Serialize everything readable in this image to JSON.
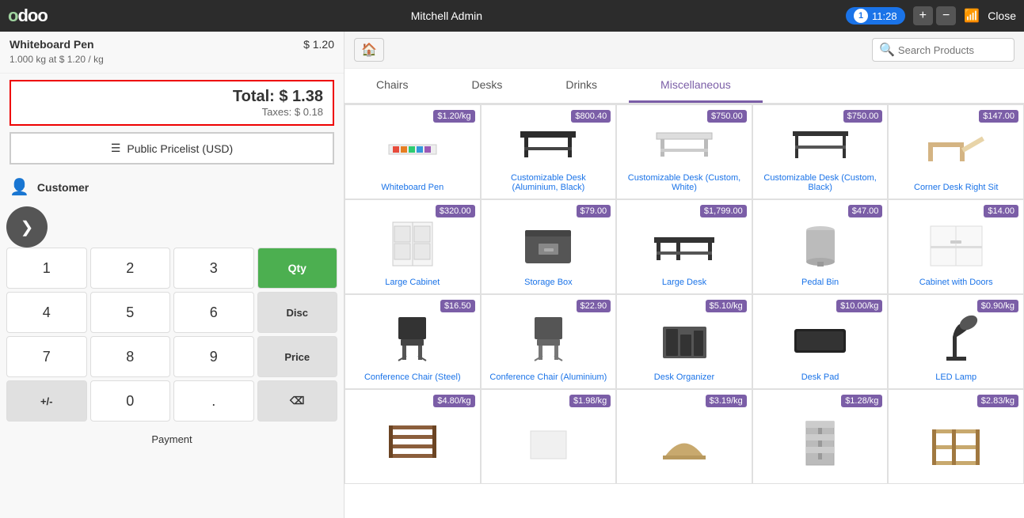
{
  "topbar": {
    "logo": "odoo",
    "user": "Mitchell Admin",
    "order_number": "1",
    "time": "11:28",
    "add_tab": "+",
    "remove_tab": "−",
    "close_label": "Close"
  },
  "left": {
    "order_line": {
      "name": "Whiteboard Pen",
      "price": "$ 1.20",
      "desc": "1.000  kg at $ 1.20 / kg"
    },
    "total": "Total: $ 1.38",
    "taxes": "Taxes: $ 0.18",
    "pricelist": "Public Pricelist (USD)",
    "customer_label": "Customer",
    "numpad": {
      "keys": [
        [
          "1",
          "2",
          "3",
          "Qty"
        ],
        [
          "4",
          "5",
          "6",
          "Disc"
        ],
        [
          "7",
          "8",
          "9",
          "Price"
        ],
        [
          "+/-",
          "0",
          ".",
          "⌫"
        ]
      ]
    },
    "payment_label": "Payment"
  },
  "right": {
    "search_placeholder": "Search Products",
    "categories": [
      "Chairs",
      "Desks",
      "Drinks",
      "Miscellaneous"
    ],
    "active_category": "Miscellaneous",
    "products": [
      {
        "name": "Whiteboard Pen",
        "price": "$1.20/kg",
        "shape": "pen"
      },
      {
        "name": "Customizable Desk (Aluminium, Black)",
        "price": "$800.40",
        "shape": "desk-black"
      },
      {
        "name": "Customizable Desk (Custom, White)",
        "price": "$750.00",
        "shape": "desk-white"
      },
      {
        "name": "Customizable Desk (Custom, Black)",
        "price": "$750.00",
        "shape": "desk-custom-black"
      },
      {
        "name": "Corner Desk Right Sit",
        "price": "$147.00",
        "shape": "desk-corner"
      },
      {
        "name": "Large Cabinet",
        "price": "$320.00",
        "shape": "cabinet-large"
      },
      {
        "name": "Storage Box",
        "price": "$79.00",
        "shape": "box"
      },
      {
        "name": "Large Desk",
        "price": "$1,799.00",
        "shape": "desk-large"
      },
      {
        "name": "Pedal Bin",
        "price": "$47.00",
        "shape": "bin"
      },
      {
        "name": "Cabinet with Doors",
        "price": "$14.00",
        "shape": "cabinet-doors"
      },
      {
        "name": "Conference Chair (Steel)",
        "price": "$16.50",
        "shape": "chair-steel"
      },
      {
        "name": "Conference Chair (Aluminium)",
        "price": "$22.90",
        "shape": "chair-alum"
      },
      {
        "name": "Desk Organizer",
        "price": "$5.10/kg",
        "shape": "organizer"
      },
      {
        "name": "Desk Pad",
        "price": "$10.00/kg",
        "shape": "pad"
      },
      {
        "name": "LED Lamp",
        "price": "$0.90/kg",
        "shape": "lamp"
      },
      {
        "name": "",
        "price": "$4.80/kg",
        "shape": "shelf1"
      },
      {
        "name": "",
        "price": "$1.98/kg",
        "shape": "shelf2"
      },
      {
        "name": "",
        "price": "$3.19/kg",
        "shape": "shelf3"
      },
      {
        "name": "",
        "price": "$1.28/kg",
        "shape": "shelf4"
      },
      {
        "name": "",
        "price": "$2.83/kg",
        "shape": "shelf5"
      }
    ]
  }
}
